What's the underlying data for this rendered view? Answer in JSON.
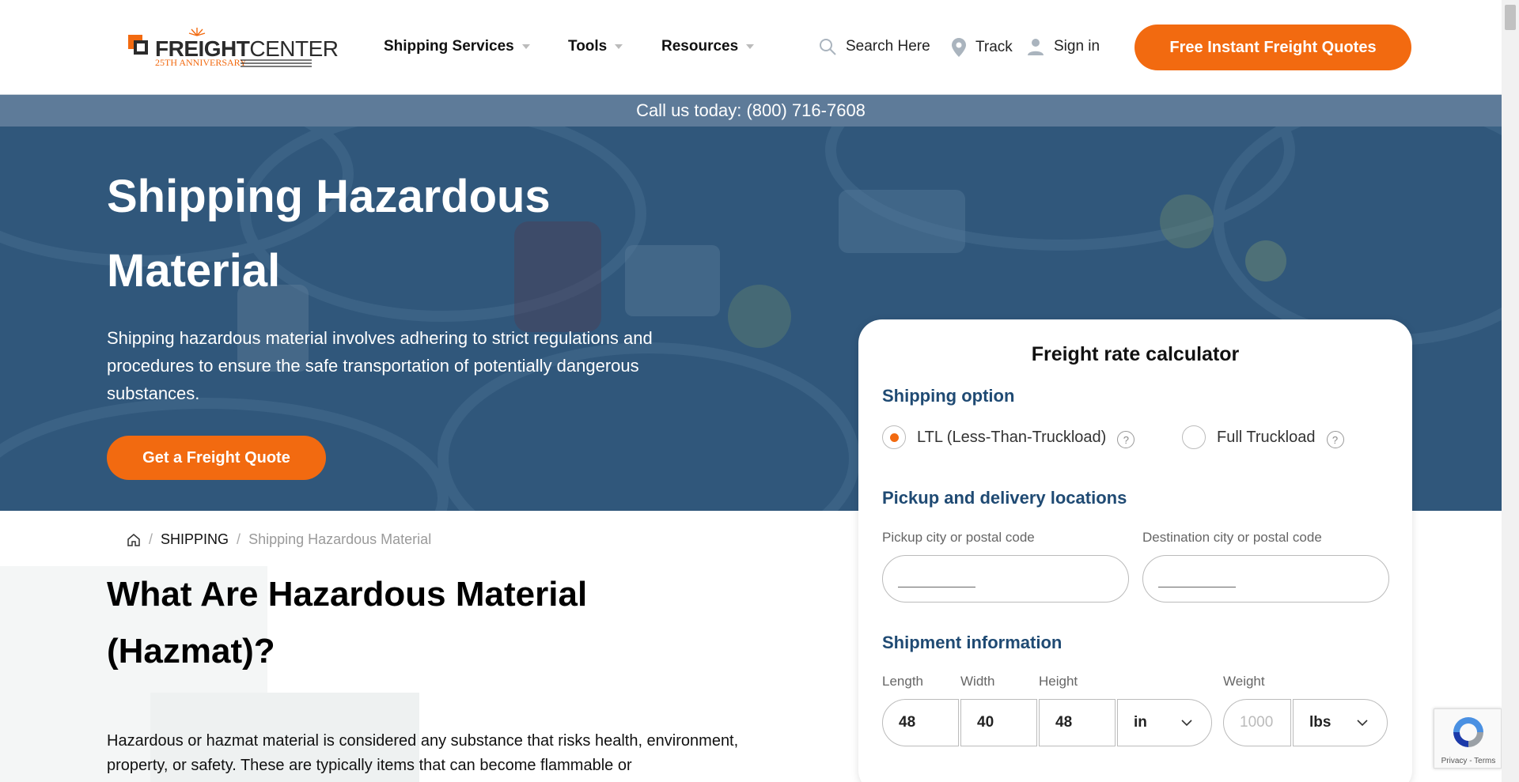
{
  "logo": {
    "word_bold": "FREIGHT",
    "word_light": "CENTER",
    "tagline": "25TH ANNIVERSARY"
  },
  "nav": {
    "items": [
      {
        "label": "Shipping Services"
      },
      {
        "label": "Tools"
      },
      {
        "label": "Resources"
      }
    ],
    "search_label": "Search Here",
    "track_label": "Track",
    "signin_label": "Sign in",
    "cta_label": "Free Instant Freight Quotes"
  },
  "phone_bar": {
    "text": "Call us today: (800) 716-7608"
  },
  "hero": {
    "title": "Shipping Hazardous Material",
    "description": "Shipping hazardous material involves adhering to strict regulations and procedures to ensure the safe transportation of potentially dangerous substances.",
    "button_label": "Get a Freight Quote"
  },
  "breadcrumb": {
    "items": [
      "SHIPPING",
      "Shipping Hazardous Material"
    ]
  },
  "article": {
    "heading": "What Are Hazardous Material (Hazmat)?",
    "paragraph": "Hazardous or hazmat material is considered any substance that risks health, environment, property, or safety. These are typically items that can become flammable or"
  },
  "calculator": {
    "title": "Freight rate calculator",
    "shipping_option_heading": "Shipping option",
    "option_ltl": "LTL (Less-Than-Truckload)",
    "option_ftl": "Full Truckload",
    "selected_option": "LTL (Less-Than-Truckload)",
    "locations_heading": "Pickup and delivery locations",
    "pickup_label": "Pickup city or postal code",
    "destination_label": "Destination city or postal code",
    "shipment_heading": "Shipment information",
    "length_label": "Length",
    "width_label": "Width",
    "height_label": "Height",
    "weight_label": "Weight",
    "length_value": "48",
    "width_value": "40",
    "height_value": "48",
    "dim_unit": "in",
    "weight_placeholder": "1000",
    "weight_unit": "lbs"
  },
  "recaptcha": {
    "text": "Privacy - Terms"
  },
  "colors": {
    "brand_orange": "#f26a10",
    "heading_blue": "#1f4a73",
    "phone_bar": "#5e7b99"
  }
}
